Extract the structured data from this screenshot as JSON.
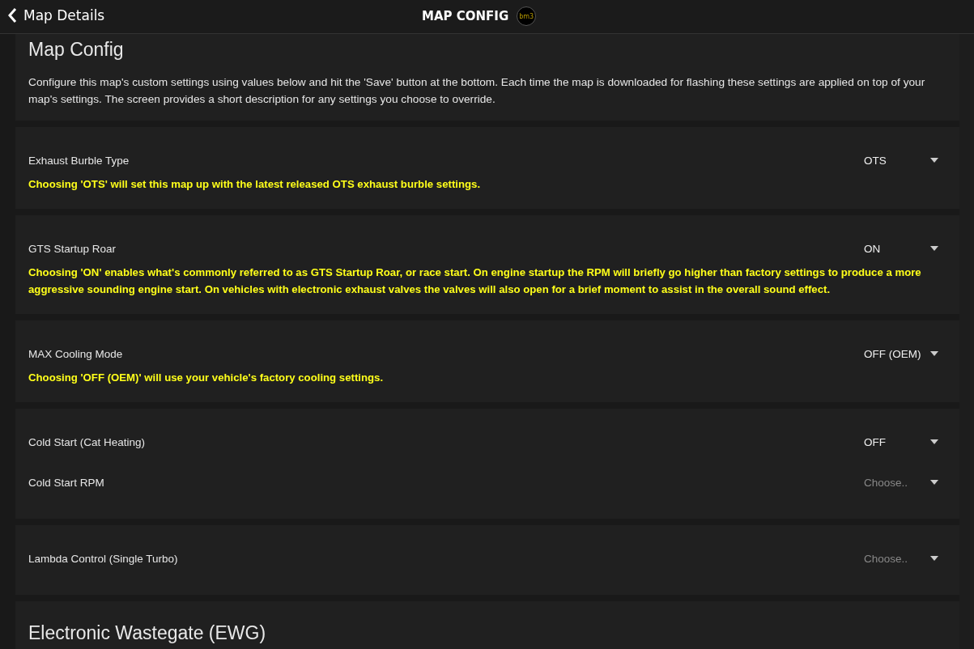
{
  "header": {
    "back_label": "Map Details",
    "title": "MAP CONFIG",
    "logo_text": "bm3"
  },
  "intro": {
    "title": "Map Config",
    "description": "Configure this map's custom settings using values below and hit the 'Save' button at the bottom. Each time the map is downloaded for flashing these settings are applied on top of your map's settings. The screen provides a short description for any settings you choose to override."
  },
  "groups": [
    {
      "settings": [
        {
          "label": "Exhaust Burble Type",
          "value": "OTS"
        }
      ],
      "note": "Choosing 'OTS' will set this map up with the latest released OTS exhaust burble settings."
    },
    {
      "settings": [
        {
          "label": "GTS Startup Roar",
          "value": "ON"
        }
      ],
      "note": "Choosing 'ON' enables what's commonly referred to as GTS Startup Roar, or race start. On engine startup the RPM will briefly go higher than factory settings to produce a more aggressive sounding engine start. On vehicles with electronic exhaust valves the valves will also open for a brief moment to assist in the overall sound effect."
    },
    {
      "settings": [
        {
          "label": "MAX Cooling Mode",
          "value": "OFF (OEM)"
        }
      ],
      "note": "Choosing 'OFF (OEM)' will use your vehicle's factory cooling settings."
    },
    {
      "settings": [
        {
          "label": "Cold Start (Cat Heating)",
          "value": "OFF"
        },
        {
          "label": "Cold Start RPM",
          "placeholder": "Choose.."
        }
      ]
    },
    {
      "settings": [
        {
          "label": "Lambda Control (Single Turbo)",
          "placeholder": "Choose.."
        }
      ]
    }
  ],
  "section": {
    "title": "Electronic Wastegate (EWG)"
  }
}
